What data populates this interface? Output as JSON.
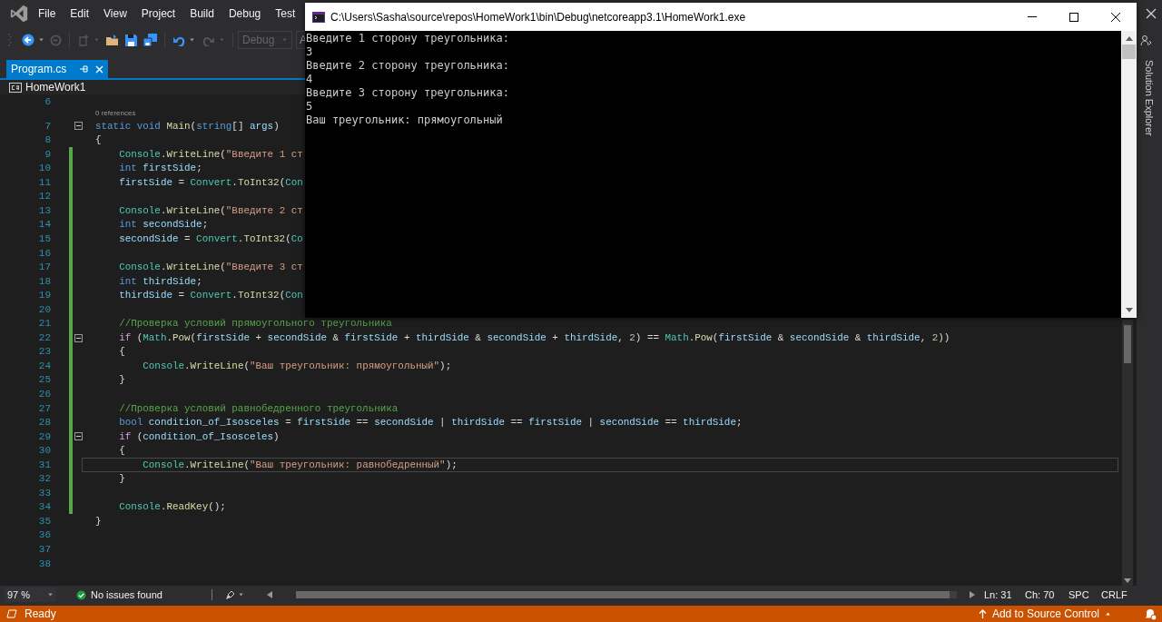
{
  "menu": [
    "File",
    "Edit",
    "View",
    "Project",
    "Build",
    "Debug",
    "Test"
  ],
  "toolbar": {
    "configuration": {
      "value": "Debug",
      "disabled": true
    },
    "platform": {
      "value": "A"
    }
  },
  "file_tab": {
    "label": "Program.cs",
    "selected": true
  },
  "nav_bar": {
    "project": "HomeWork1"
  },
  "editor": {
    "lines": [
      {
        "n": "6",
        "fold": false,
        "changed": false,
        "current": false
      },
      {
        "n": "7",
        "fold": true,
        "changed": false,
        "current": false,
        "codelens": "0 references",
        "code": [
          {
            "kind": "kw",
            "text": "static "
          },
          {
            "kind": "kw",
            "text": "void "
          },
          {
            "kind": "method",
            "text": "Main"
          },
          {
            "kind": "pl",
            "text": "("
          },
          {
            "kind": "kw",
            "text": "string"
          },
          {
            "kind": "pl",
            "text": "[] "
          },
          {
            "kind": "var",
            "text": "args"
          },
          {
            "kind": "pl",
            "text": ")"
          }
        ]
      },
      {
        "n": "8",
        "fold": false,
        "changed": false,
        "current": false,
        "code": [
          {
            "kind": "pl",
            "text": "{"
          }
        ]
      },
      {
        "n": "9",
        "fold": false,
        "changed": true,
        "current": false,
        "code": [
          {
            "kind": "type",
            "text": "    Console"
          },
          {
            "kind": "pl",
            "text": "."
          },
          {
            "kind": "method",
            "text": "WriteLine"
          },
          {
            "kind": "pl",
            "text": "("
          },
          {
            "kind": "str",
            "text": "\"Введите 1 ст"
          }
        ]
      },
      {
        "n": "10",
        "fold": false,
        "changed": true,
        "current": false,
        "code": [
          {
            "kind": "kw",
            "text": "    int "
          },
          {
            "kind": "var",
            "text": "firstSide"
          },
          {
            "kind": "pl",
            "text": ";"
          }
        ]
      },
      {
        "n": "11",
        "fold": false,
        "changed": true,
        "current": false,
        "code": [
          {
            "kind": "var",
            "text": "    firstSide"
          },
          {
            "kind": "pl",
            "text": " = "
          },
          {
            "kind": "type",
            "text": "Convert"
          },
          {
            "kind": "pl",
            "text": "."
          },
          {
            "kind": "method",
            "text": "ToInt32"
          },
          {
            "kind": "pl",
            "text": "("
          },
          {
            "kind": "type",
            "text": "Con"
          }
        ]
      },
      {
        "n": "12",
        "fold": false,
        "changed": true,
        "current": false
      },
      {
        "n": "13",
        "fold": false,
        "changed": true,
        "current": false,
        "code": [
          {
            "kind": "type",
            "text": "    Console"
          },
          {
            "kind": "pl",
            "text": "."
          },
          {
            "kind": "method",
            "text": "WriteLine"
          },
          {
            "kind": "pl",
            "text": "("
          },
          {
            "kind": "str",
            "text": "\"Введите 2 ст"
          }
        ]
      },
      {
        "n": "14",
        "fold": false,
        "changed": true,
        "current": false,
        "code": [
          {
            "kind": "kw",
            "text": "    int "
          },
          {
            "kind": "var",
            "text": "secondSide"
          },
          {
            "kind": "pl",
            "text": ";"
          }
        ]
      },
      {
        "n": "15",
        "fold": false,
        "changed": true,
        "current": false,
        "code": [
          {
            "kind": "var",
            "text": "    secondSide"
          },
          {
            "kind": "pl",
            "text": " = "
          },
          {
            "kind": "type",
            "text": "Convert"
          },
          {
            "kind": "pl",
            "text": "."
          },
          {
            "kind": "method",
            "text": "ToInt32"
          },
          {
            "kind": "pl",
            "text": "("
          },
          {
            "kind": "type",
            "text": "Co"
          }
        ]
      },
      {
        "n": "16",
        "fold": false,
        "changed": true,
        "current": false
      },
      {
        "n": "17",
        "fold": false,
        "changed": true,
        "current": false,
        "code": [
          {
            "kind": "type",
            "text": "    Console"
          },
          {
            "kind": "pl",
            "text": "."
          },
          {
            "kind": "method",
            "text": "WriteLine"
          },
          {
            "kind": "pl",
            "text": "("
          },
          {
            "kind": "str",
            "text": "\"Введите 3 ст"
          }
        ]
      },
      {
        "n": "18",
        "fold": false,
        "changed": true,
        "current": false,
        "code": [
          {
            "kind": "kw",
            "text": "    int "
          },
          {
            "kind": "var",
            "text": "thirdSide"
          },
          {
            "kind": "pl",
            "text": ";"
          }
        ]
      },
      {
        "n": "19",
        "fold": false,
        "changed": true,
        "current": false,
        "code": [
          {
            "kind": "var",
            "text": "    thirdSide"
          },
          {
            "kind": "pl",
            "text": " = "
          },
          {
            "kind": "type",
            "text": "Convert"
          },
          {
            "kind": "pl",
            "text": "."
          },
          {
            "kind": "method",
            "text": "ToInt32"
          },
          {
            "kind": "pl",
            "text": "("
          },
          {
            "kind": "type",
            "text": "Con"
          }
        ]
      },
      {
        "n": "20",
        "fold": false,
        "changed": true,
        "current": false
      },
      {
        "n": "21",
        "fold": false,
        "changed": true,
        "current": false,
        "code": [
          {
            "kind": "cmt",
            "text": "    //Проверка условий прямоугольного треугольника"
          }
        ]
      },
      {
        "n": "22",
        "fold": true,
        "changed": true,
        "current": false,
        "code": [
          {
            "kind": "ctl",
            "text": "    if"
          },
          {
            "kind": "pl",
            "text": " ("
          },
          {
            "kind": "type",
            "text": "Math"
          },
          {
            "kind": "pl",
            "text": "."
          },
          {
            "kind": "method",
            "text": "Pow"
          },
          {
            "kind": "pl",
            "text": "("
          },
          {
            "kind": "var",
            "text": "firstSide"
          },
          {
            "kind": "pl",
            "text": " + "
          },
          {
            "kind": "var",
            "text": "secondSide"
          },
          {
            "kind": "pl",
            "text": " & "
          },
          {
            "kind": "var",
            "text": "firstSide"
          },
          {
            "kind": "pl",
            "text": " + "
          },
          {
            "kind": "var",
            "text": "thirdSide"
          },
          {
            "kind": "pl",
            "text": " & "
          },
          {
            "kind": "var",
            "text": "secondSide"
          },
          {
            "kind": "pl",
            "text": " + "
          },
          {
            "kind": "var",
            "text": "thirdSide"
          },
          {
            "kind": "pl",
            "text": ", "
          },
          {
            "kind": "num",
            "text": "2"
          },
          {
            "kind": "pl",
            "text": ") == "
          },
          {
            "kind": "type",
            "text": "Math"
          },
          {
            "kind": "pl",
            "text": "."
          },
          {
            "kind": "method",
            "text": "Pow"
          },
          {
            "kind": "pl",
            "text": "("
          },
          {
            "kind": "var",
            "text": "firstSide"
          },
          {
            "kind": "pl",
            "text": " & "
          },
          {
            "kind": "var",
            "text": "secondSide"
          },
          {
            "kind": "pl",
            "text": " & "
          },
          {
            "kind": "var",
            "text": "thirdSide"
          },
          {
            "kind": "pl",
            "text": ", "
          },
          {
            "kind": "num",
            "text": "2"
          },
          {
            "kind": "pl",
            "text": "))"
          }
        ]
      },
      {
        "n": "23",
        "fold": false,
        "changed": true,
        "current": false,
        "code": [
          {
            "kind": "pl",
            "text": "    {"
          }
        ]
      },
      {
        "n": "24",
        "fold": false,
        "changed": true,
        "current": false,
        "code": [
          {
            "kind": "type",
            "text": "        Console"
          },
          {
            "kind": "pl",
            "text": "."
          },
          {
            "kind": "method",
            "text": "WriteLine"
          },
          {
            "kind": "pl",
            "text": "("
          },
          {
            "kind": "str",
            "text": "\"Ваш треугольник: прямоугольный\""
          },
          {
            "kind": "pl",
            "text": ");"
          }
        ]
      },
      {
        "n": "25",
        "fold": false,
        "changed": true,
        "current": false,
        "code": [
          {
            "kind": "pl",
            "text": "    }"
          }
        ]
      },
      {
        "n": "26",
        "fold": false,
        "changed": true,
        "current": false
      },
      {
        "n": "27",
        "fold": false,
        "changed": true,
        "current": false,
        "code": [
          {
            "kind": "cmt",
            "text": "    //Проверка условий равнобедренного треугольника"
          }
        ]
      },
      {
        "n": "28",
        "fold": false,
        "changed": true,
        "current": false,
        "code": [
          {
            "kind": "kw",
            "text": "    bool "
          },
          {
            "kind": "var",
            "text": "condition_of_Isosceles"
          },
          {
            "kind": "pl",
            "text": " = "
          },
          {
            "kind": "var",
            "text": "firstSide"
          },
          {
            "kind": "pl",
            "text": " == "
          },
          {
            "kind": "var",
            "text": "secondSide"
          },
          {
            "kind": "pl",
            "text": " | "
          },
          {
            "kind": "var",
            "text": "thirdSide"
          },
          {
            "kind": "pl",
            "text": " == "
          },
          {
            "kind": "var",
            "text": "firstSide"
          },
          {
            "kind": "pl",
            "text": " | "
          },
          {
            "kind": "var",
            "text": "secondSide"
          },
          {
            "kind": "pl",
            "text": " == "
          },
          {
            "kind": "var",
            "text": "thirdSide"
          },
          {
            "kind": "pl",
            "text": ";"
          }
        ]
      },
      {
        "n": "29",
        "fold": true,
        "changed": true,
        "current": false,
        "code": [
          {
            "kind": "ctl",
            "text": "    if"
          },
          {
            "kind": "pl",
            "text": " ("
          },
          {
            "kind": "var",
            "text": "condition_of_Isosceles"
          },
          {
            "kind": "pl",
            "text": ")"
          }
        ]
      },
      {
        "n": "30",
        "fold": false,
        "changed": true,
        "current": false,
        "code": [
          {
            "kind": "pl",
            "text": "    {"
          }
        ]
      },
      {
        "n": "31",
        "fold": false,
        "changed": true,
        "current": true,
        "code": [
          {
            "kind": "type",
            "text": "        Console"
          },
          {
            "kind": "pl",
            "text": "."
          },
          {
            "kind": "method",
            "text": "WriteLine"
          },
          {
            "kind": "pl",
            "text": "("
          },
          {
            "kind": "str",
            "text": "\"Ваш треугольник: равнобедренный\""
          },
          {
            "kind": "pl",
            "text": ");"
          }
        ]
      },
      {
        "n": "32",
        "fold": false,
        "changed": true,
        "current": false,
        "code": [
          {
            "kind": "pl",
            "text": "    }"
          }
        ]
      },
      {
        "n": "33",
        "fold": false,
        "changed": true,
        "current": false
      },
      {
        "n": "34",
        "fold": false,
        "changed": true,
        "current": false,
        "code": [
          {
            "kind": "type",
            "text": "    Console"
          },
          {
            "kind": "pl",
            "text": "."
          },
          {
            "kind": "method",
            "text": "ReadKey"
          },
          {
            "kind": "pl",
            "text": "();"
          }
        ]
      },
      {
        "n": "35",
        "fold": false,
        "changed": false,
        "current": false,
        "code": [
          {
            "kind": "pl",
            "text": "}"
          }
        ]
      },
      {
        "n": "36",
        "fold": false,
        "changed": false,
        "current": false
      },
      {
        "n": "37",
        "fold": false,
        "changed": false,
        "current": false
      },
      {
        "n": "38",
        "fold": false,
        "changed": false,
        "current": false
      }
    ]
  },
  "editor_status": {
    "zoom": "97 %",
    "issues": "No issues found",
    "line": "Ln: 31",
    "column": "Ch: 70",
    "whitespace": "SPC",
    "line_endings": "CRLF"
  },
  "side_tab": "Solution Explorer",
  "console": {
    "title": "C:\\Users\\Sasha\\source\\repos\\HomeWork1\\bin\\Debug\\netcoreapp3.1\\HomeWork1.exe",
    "lines": [
      "Введите 1 сторону треугольника:",
      "3",
      "Введите 2 сторону треугольника:",
      "4",
      "Введите 3 сторону треугольника:",
      "5",
      "Ваш треугольник: прямоугольный"
    ]
  },
  "status_bar": {
    "state": "Ready",
    "source_control": "Add to Source Control"
  }
}
